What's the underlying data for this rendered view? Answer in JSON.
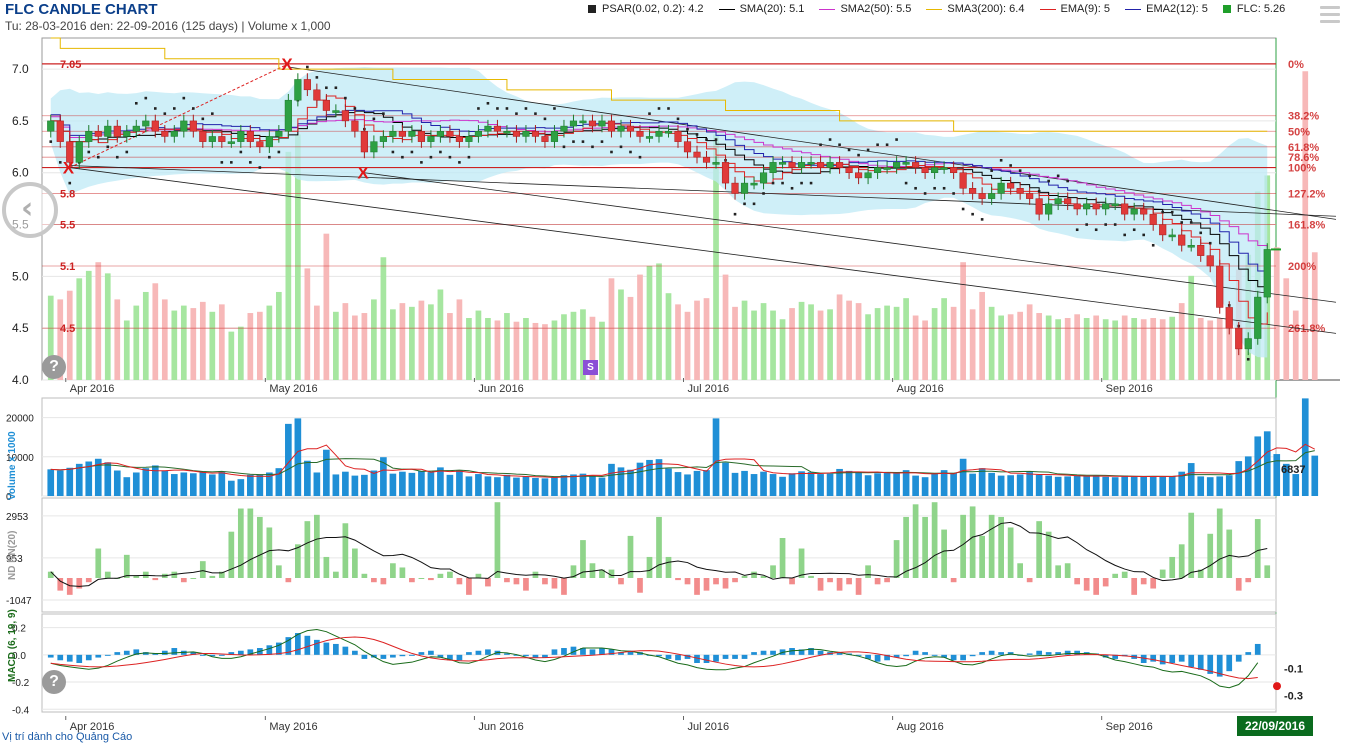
{
  "header": {
    "title": "FLC CANDLE CHART",
    "subtitle": "Tu: 28-03-2016 den: 22-09-2016 (125 days) | Volume x 1,000"
  },
  "legend": [
    {
      "label": "PSAR(0.02, 0.2): 4.2",
      "color": "#222222",
      "kind": "square"
    },
    {
      "label": "SMA(20): 5.1",
      "color": "#000000",
      "kind": "line"
    },
    {
      "label": "SMA2(50): 5.5",
      "color": "#cc33cc",
      "kind": "line"
    },
    {
      "label": "SMA3(200): 6.4",
      "color": "#e6b800",
      "kind": "line"
    },
    {
      "label": "EMA(9): 5",
      "color": "#dd2222",
      "kind": "line"
    },
    {
      "label": "EMA2(12): 5",
      "color": "#2222aa",
      "kind": "line"
    },
    {
      "label": "FLC: 5.26",
      "color": "#1f9f2a",
      "kind": "square"
    }
  ],
  "colors": {
    "up": "#2ea043",
    "down": "#e03a3a",
    "vol_up": "#a6e6a0",
    "vol_down": "#f7b8b8",
    "bollinger": "#bfe9f6",
    "fib": "#cc2222",
    "volume_bar": "#1f8fd6",
    "macd_hist": "#1f8fd6"
  },
  "icons": [
    "menu-icon",
    "chevron-left-icon",
    "help-icon"
  ],
  "ad_text": "Vị trí dành cho Quảng Cáo",
  "date_badge": "22/09/2016",
  "s_marker": "S",
  "chart_data": [
    {
      "type": "candlestick",
      "name": "price",
      "ylim": [
        4.0,
        7.3
      ],
      "ytick_labels": [
        "4.0",
        "4.5",
        "5.0",
        "5.5",
        "6.0",
        "6.5",
        "7.0"
      ],
      "month_labels": [
        "Apr 2016",
        "May 2016",
        "Jun 2016",
        "Jul 2016",
        "Aug 2016",
        "Sep 2016"
      ],
      "fib_levels": [
        {
          "price": 7.05,
          "label": "0%"
        },
        {
          "price": 6.55,
          "label": "38.2%"
        },
        {
          "price": 6.4,
          "label": "50%"
        },
        {
          "price": 6.25,
          "label": "61.8%"
        },
        {
          "price": 6.15,
          "label": "78.6%"
        },
        {
          "price": 6.05,
          "label": "100%"
        },
        {
          "price": 5.8,
          "label": "127.2%"
        },
        {
          "price": 5.5,
          "label": "161.8%"
        },
        {
          "price": 5.1,
          "label": "200%"
        },
        {
          "price": 4.5,
          "label": "261.8%"
        }
      ],
      "left_price_marks": [
        "7.05",
        "5.8",
        "5.5",
        "5.1",
        "4.5"
      ],
      "pivots": [
        {
          "label": "X",
          "i": 2,
          "price": 6.05
        },
        {
          "label": "X",
          "i": 25,
          "price": 7.05
        },
        {
          "label": "X",
          "i": 33,
          "price": 6.0
        }
      ],
      "last": 5.26,
      "closes": [
        6.5,
        6.3,
        6.1,
        6.3,
        6.4,
        6.35,
        6.45,
        6.35,
        6.4,
        6.45,
        6.5,
        6.4,
        6.35,
        6.4,
        6.5,
        6.4,
        6.3,
        6.35,
        6.3,
        6.3,
        6.4,
        6.3,
        6.25,
        6.35,
        6.4,
        6.7,
        6.9,
        6.8,
        6.7,
        6.6,
        6.6,
        6.5,
        6.4,
        6.2,
        6.3,
        6.35,
        6.4,
        6.35,
        6.4,
        6.3,
        6.35,
        6.4,
        6.35,
        6.3,
        6.35,
        6.4,
        6.45,
        6.4,
        6.4,
        6.35,
        6.4,
        6.35,
        6.3,
        6.4,
        6.45,
        6.5,
        6.5,
        6.45,
        6.5,
        6.4,
        6.45,
        6.4,
        6.35,
        6.35,
        6.4,
        6.4,
        6.3,
        6.2,
        6.15,
        6.1,
        6.1,
        5.9,
        5.8,
        5.9,
        5.9,
        6.0,
        6.1,
        6.1,
        6.05,
        6.1,
        6.1,
        6.05,
        6.1,
        6.05,
        6.0,
        5.95,
        6.0,
        6.05,
        6.05,
        6.1,
        6.1,
        6.05,
        6.0,
        6.05,
        6.05,
        6.0,
        5.85,
        5.8,
        5.75,
        5.8,
        5.9,
        5.85,
        5.8,
        5.75,
        5.6,
        5.7,
        5.75,
        5.7,
        5.65,
        5.7,
        5.65,
        5.7,
        5.7,
        5.6,
        5.65,
        5.6,
        5.5,
        5.4,
        5.4,
        5.3,
        5.3,
        5.2,
        5.1,
        4.7,
        4.5,
        4.3,
        4.4,
        4.8,
        5.26
      ]
    },
    {
      "type": "bar",
      "name": "volume",
      "ylabel": "Volume x 1000",
      "ytick_labels": [
        "0",
        "10000",
        "20000"
      ],
      "ylim": [
        0,
        25000
      ],
      "last_label": "6837",
      "values": [
        6800,
        6500,
        7200,
        8200,
        8800,
        9500,
        8600,
        6500,
        4800,
        6000,
        7100,
        7800,
        6500,
        5600,
        6000,
        5800,
        6300,
        5500,
        6100,
        3900,
        4300,
        5400,
        5500,
        6000,
        7100,
        18400,
        19800,
        9000,
        6000,
        11800,
        5500,
        6200,
        5200,
        5400,
        6500,
        9900,
        5700,
        6200,
        5900,
        6400,
        6100,
        7300,
        5400,
        6500,
        5000,
        5600,
        5000,
        4800,
        5400,
        4700,
        5000,
        4600,
        4500,
        4800,
        5300,
        5500,
        5700,
        5100,
        4700,
        8200,
        7300,
        6700,
        8500,
        9200,
        9400,
        7000,
        6100,
        5500,
        6400,
        6600,
        19800,
        8500,
        5900,
        6400,
        5600,
        6200,
        5600,
        4900,
        5800,
        6300,
        6100,
        5600,
        5700,
        6900,
        6400,
        6200,
        5300,
        5800,
        6000,
        5900,
        6600,
        5200,
        4800,
        5800,
        6600,
        5900,
        9500,
        5700,
        7100,
        5900,
        5200,
        5300,
        5500,
        6100,
        5400,
        5200,
        4900,
        5000,
        5300,
        5000,
        5200,
        4900,
        4800,
        5200,
        5000,
        4900,
        5000,
        4900,
        5100,
        6200,
        8400,
        5000,
        4800,
        5000,
        5300,
        8900,
        10100,
        15200,
        16500,
        10700,
        8200,
        5600,
        24900,
        10300
      ]
    },
    {
      "type": "bar",
      "name": "foreign_net",
      "ylabel": "ND NN(20)",
      "ytick_labels": [
        "-1047",
        "953",
        "2953"
      ],
      "values": [
        300,
        -600,
        -800,
        -500,
        -200,
        1400,
        300,
        0,
        1100,
        100,
        300,
        -100,
        200,
        300,
        -200,
        0,
        800,
        100,
        300,
        2200,
        3300,
        3300,
        2900,
        2400,
        600,
        -200,
        1600,
        2700,
        3000,
        1000,
        300,
        2600,
        1400,
        200,
        -200,
        -300,
        700,
        500,
        -200,
        0,
        -100,
        200,
        300,
        -300,
        -800,
        200,
        -400,
        3600,
        -200,
        -300,
        -600,
        300,
        -300,
        -500,
        -800,
        600,
        1800,
        700,
        400,
        400,
        -300,
        2000,
        -700,
        1000,
        2900,
        1000,
        -100,
        -300,
        -800,
        -600,
        -300,
        -500,
        -200,
        100,
        300,
        100,
        600,
        1900,
        -300,
        1400,
        100,
        -600,
        -200,
        -600,
        -300,
        -800,
        600,
        -300,
        -200,
        1800,
        2900,
        3500,
        2900,
        3600,
        2300,
        -200,
        3000,
        3400,
        2000,
        3000,
        2900,
        2400,
        700,
        -200,
        2700,
        2200,
        600,
        700,
        -300,
        -600,
        -800,
        -400,
        200,
        300,
        -800,
        -300,
        -500,
        400,
        1000,
        1600,
        3100,
        400,
        2100,
        3300,
        2300,
        -600,
        -200,
        2800,
        600,
        400,
        -800,
        -900,
        -600,
        -300,
        -500,
        -300,
        -400,
        -600,
        -300,
        -400,
        -300
      ]
    },
    {
      "type": "bar",
      "name": "macd",
      "ylabel": "MACD (6, 19, 9)",
      "ytick_labels": [
        "-0.4",
        "-0.2",
        "0.0",
        "0.2"
      ],
      "ylim": [
        -0.42,
        0.3
      ],
      "right_labels": [
        "-0.1",
        "-0.3"
      ],
      "values": [
        -0.02,
        -0.04,
        -0.05,
        -0.06,
        -0.04,
        -0.02,
        0.0,
        0.02,
        0.03,
        0.04,
        0.02,
        0.01,
        0.03,
        0.05,
        0.03,
        0.02,
        0.0,
        -0.01,
        0.0,
        0.02,
        0.03,
        0.04,
        0.05,
        0.07,
        0.09,
        0.13,
        0.16,
        0.14,
        0.11,
        0.09,
        0.08,
        0.06,
        0.03,
        -0.03,
        -0.02,
        -0.03,
        -0.02,
        -0.01,
        0.0,
        0.02,
        0.03,
        -0.02,
        -0.04,
        -0.04,
        0.02,
        0.03,
        0.04,
        0.03,
        0.01,
        0.0,
        -0.01,
        -0.02,
        -0.02,
        0.04,
        0.05,
        0.06,
        0.05,
        0.04,
        0.05,
        0.04,
        0.02,
        0.03,
        0.02,
        0.0,
        -0.01,
        -0.03,
        -0.04,
        -0.03,
        -0.06,
        -0.06,
        -0.05,
        -0.03,
        -0.03,
        -0.03,
        0.02,
        0.03,
        0.03,
        0.04,
        0.05,
        0.04,
        0.05,
        0.03,
        0.02,
        0.02,
        0.01,
        0.0,
        -0.03,
        -0.05,
        -0.04,
        -0.02,
        -0.01,
        0.03,
        0.02,
        0.0,
        -0.02,
        -0.04,
        -0.04,
        -0.01,
        0.02,
        0.03,
        0.02,
        0.02,
        0.0,
        0.01,
        0.03,
        0.02,
        0.02,
        0.03,
        0.03,
        0.02,
        0.01,
        -0.02,
        -0.03,
        -0.01,
        -0.03,
        -0.06,
        -0.05,
        -0.07,
        -0.06,
        -0.05,
        -0.09,
        -0.11,
        -0.14,
        -0.16,
        -0.12,
        -0.05,
        0.02,
        0.08
      ]
    }
  ]
}
